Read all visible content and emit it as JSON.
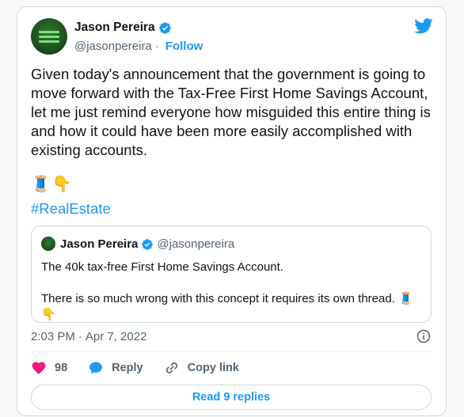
{
  "author": {
    "name": "Jason Pereira",
    "handle": "@jasonpereira",
    "separator": "·",
    "follow_label": "Follow"
  },
  "tweet": {
    "text": "Given today's announcement that the government is going to move forward with the Tax-Free First Home Savings Account, let me just remind everyone how misguided this entire thing is and how it could have been more easily accomplished with existing accounts.",
    "emojis": [
      "🧵",
      "👇"
    ],
    "hashtag": "#RealEstate"
  },
  "quote": {
    "name": "Jason Pereira",
    "handle": "@jasonpereira",
    "line1": "The 40k tax-free First Home Savings Account.",
    "line2": "There is so much wrong with this concept it requires its own thread. 🧵👇"
  },
  "meta": {
    "time": "2:03 PM",
    "separator": "·",
    "date": "Apr 7, 2022"
  },
  "actions": {
    "likes": "98",
    "reply_label": "Reply",
    "copy_label": "Copy link"
  },
  "read_replies_label": "Read 9 replies",
  "colors": {
    "accent": "#1d9bf0",
    "like": "#f91880",
    "text": "#0f1419",
    "muted": "#536471"
  },
  "icons": {
    "brand": "twitter-bird-icon",
    "verified": "verified-badge-icon",
    "info": "info-icon",
    "like": "heart-icon",
    "reply": "reply-bubble-icon",
    "copy": "link-icon"
  }
}
